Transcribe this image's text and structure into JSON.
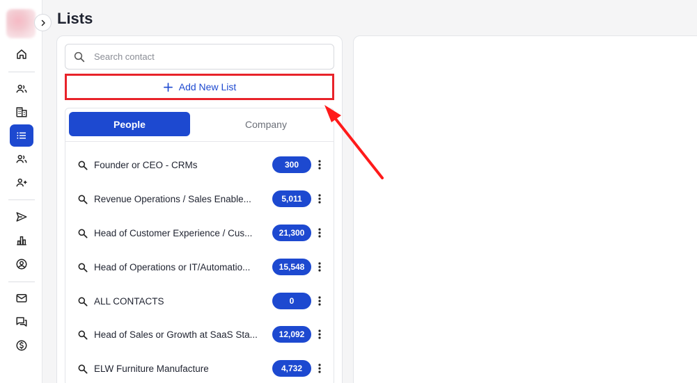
{
  "page": {
    "title": "Lists"
  },
  "sidebar": {
    "items": [
      {
        "name": "home-icon"
      },
      {
        "name": "contacts-icon"
      },
      {
        "name": "company-icon"
      },
      {
        "name": "lists-icon",
        "active": true
      },
      {
        "name": "people-icon"
      },
      {
        "name": "add-person-icon"
      },
      {
        "name": "send-icon"
      },
      {
        "name": "analytics-icon"
      },
      {
        "name": "account-icon"
      },
      {
        "name": "mail-icon"
      },
      {
        "name": "chat-icon"
      },
      {
        "name": "billing-icon"
      }
    ]
  },
  "search": {
    "placeholder": "Search contact",
    "value": ""
  },
  "actions": {
    "add_new_list": "Add New List"
  },
  "tabs": {
    "people": "People",
    "company": "Company",
    "active": "people"
  },
  "lists": [
    {
      "name": "Founder or CEO - CRMs",
      "count": "300"
    },
    {
      "name": "Revenue Operations / Sales Enable...",
      "count": "5,011"
    },
    {
      "name": "Head of Customer Experience / Cus...",
      "count": "21,300"
    },
    {
      "name": "Head of Operations or IT/Automatio...",
      "count": "15,548"
    },
    {
      "name": "ALL CONTACTS",
      "count": "0"
    },
    {
      "name": "Head of Sales or Growth at SaaS Sta...",
      "count": "12,092"
    },
    {
      "name": "ELW Furniture Manufacture",
      "count": "4,732"
    }
  ],
  "colors": {
    "accent": "#1d49d0",
    "annotation": "#e8232a"
  }
}
